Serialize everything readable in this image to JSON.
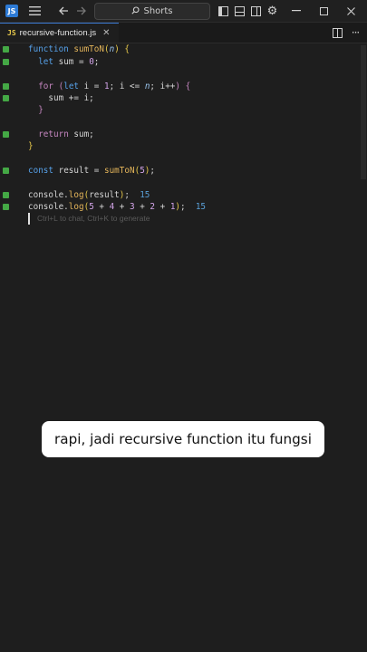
{
  "titlebar": {
    "search_label": "Shorts",
    "icons": [
      "menu-icon",
      "back-arrow-icon",
      "forward-arrow-icon",
      "search-icon",
      "layout-sidebar-left-icon",
      "layout-panel-icon",
      "layout-sidebar-right-icon",
      "gear-icon",
      "minimize-icon",
      "maximize-icon",
      "close-icon"
    ]
  },
  "tab": {
    "badge": "JS",
    "filename": "recursive-function.js",
    "close": "✕"
  },
  "editor": {
    "inline_hint_1": "15",
    "inline_hint_2": "15",
    "ghost_text": "Ctrl+L to chat, Ctrl+K to generate"
  },
  "caption": {
    "text": "rapi, jadi recursive function itu fungsi"
  },
  "colors": {
    "background": "#1e1e1e",
    "keyword": "#56a0e8",
    "function": "#e3b45a",
    "gutter": "#44a845"
  }
}
